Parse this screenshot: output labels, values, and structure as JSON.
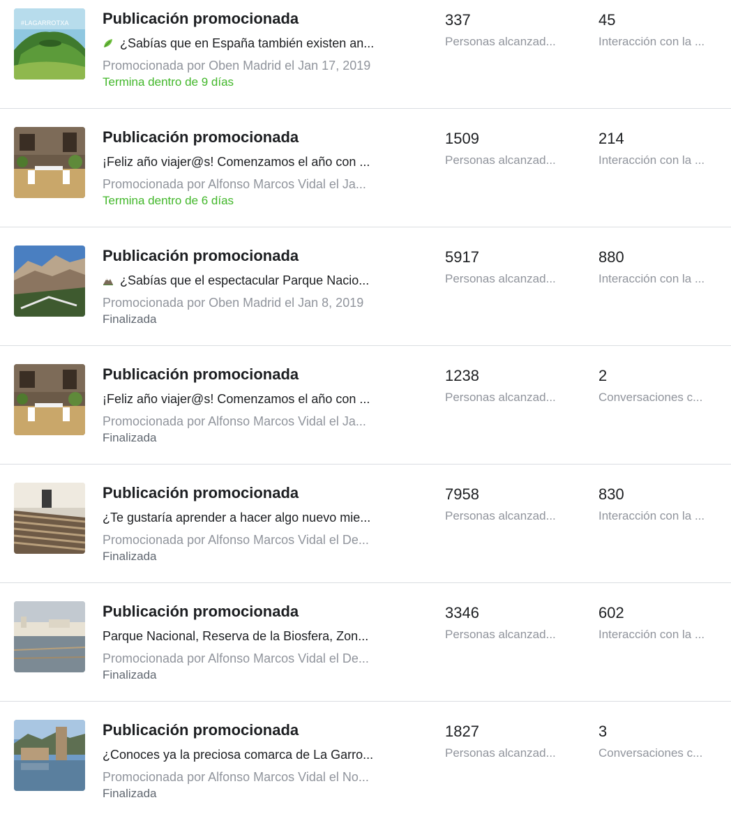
{
  "colors": {
    "active_status": "#42b72a",
    "finished_status": "#606770",
    "secondary_text": "#90949c",
    "divider": "#dadde1"
  },
  "posts": [
    {
      "title": "Publicación promocionada",
      "message_icon": "leaf-icon",
      "message": "¿Sabías que en España también existen an...",
      "promoted_by": "Promocionada por Oben Madrid el Jan 17, 2019",
      "status": "Termina dentro de 9 días",
      "status_active": true,
      "thumbnail": "volcano-landscape-thumbnail",
      "thumbnail_tag": "#LAGARROTXA",
      "metric1_value": "337",
      "metric1_label": "Personas alcanzad...",
      "metric2_value": "45",
      "metric2_label": "Interacción con la ..."
    },
    {
      "title": "Publicación promocionada",
      "message_icon": "",
      "message": "¡Feliz año viajer@s! Comenzamos el año con ...",
      "promoted_by": "Promocionada por Alfonso Marcos Vidal el Ja...",
      "status": "Termina dentro de 6 días",
      "status_active": true,
      "thumbnail": "stone-house-terrace-thumbnail",
      "thumbnail_tag": "",
      "metric1_value": "1509",
      "metric1_label": "Personas alcanzad...",
      "metric2_value": "214",
      "metric2_label": "Interacción con la ..."
    },
    {
      "title": "Publicación promocionada",
      "message_icon": "mountain-icon",
      "message": "¿Sabías que el espectacular Parque Nacio...",
      "promoted_by": "Promocionada por Oben Madrid el Jan 8, 2019",
      "status": "Finalizada",
      "status_active": false,
      "thumbnail": "mountain-canyon-thumbnail",
      "thumbnail_tag": "",
      "metric1_value": "5917",
      "metric1_label": "Personas alcanzad...",
      "metric2_value": "880",
      "metric2_label": "Interacción con la ..."
    },
    {
      "title": "Publicación promocionada",
      "message_icon": "",
      "message": "¡Feliz año viajer@s! Comenzamos el año con ...",
      "promoted_by": "Promocionada por Alfonso Marcos Vidal el Ja...",
      "status": "Finalizada",
      "status_active": false,
      "thumbnail": "stone-house-terrace-thumbnail",
      "thumbnail_tag": "",
      "metric1_value": "1238",
      "metric1_label": "Personas alcanzad...",
      "metric2_value": "2",
      "metric2_label": "Conversaciones c..."
    },
    {
      "title": "Publicación promocionada",
      "message_icon": "",
      "message": "¿Te gustaría aprender a hacer algo nuevo mie...",
      "promoted_by": "Promocionada por Alfonso Marcos Vidal el De...",
      "status": "Finalizada",
      "status_active": false,
      "thumbnail": "loom-weaving-thumbnail",
      "thumbnail_tag": "",
      "metric1_value": "7958",
      "metric1_label": "Personas alcanzad...",
      "metric2_value": "830",
      "metric2_label": "Interacción con la ..."
    },
    {
      "title": "Publicación promocionada",
      "message_icon": "",
      "message": "Parque Nacional, Reserva de la Biosfera, Zon...",
      "promoted_by": "Promocionada por Alfonso Marcos Vidal el De...",
      "status": "Finalizada",
      "status_active": false,
      "thumbnail": "wetland-village-thumbnail",
      "thumbnail_tag": "",
      "metric1_value": "3346",
      "metric1_label": "Personas alcanzad...",
      "metric2_value": "602",
      "metric2_label": "Interacción con la ..."
    },
    {
      "title": "Publicación promocionada",
      "message_icon": "",
      "message": "¿Conoces ya la preciosa comarca de La Garro...",
      "promoted_by": "Promocionada por Alfonso Marcos Vidal el No...",
      "status": "Finalizada",
      "status_active": false,
      "thumbnail": "river-town-thumbnail",
      "thumbnail_tag": "",
      "metric1_value": "1827",
      "metric1_label": "Personas alcanzad...",
      "metric2_value": "3",
      "metric2_label": "Conversaciones c..."
    }
  ]
}
